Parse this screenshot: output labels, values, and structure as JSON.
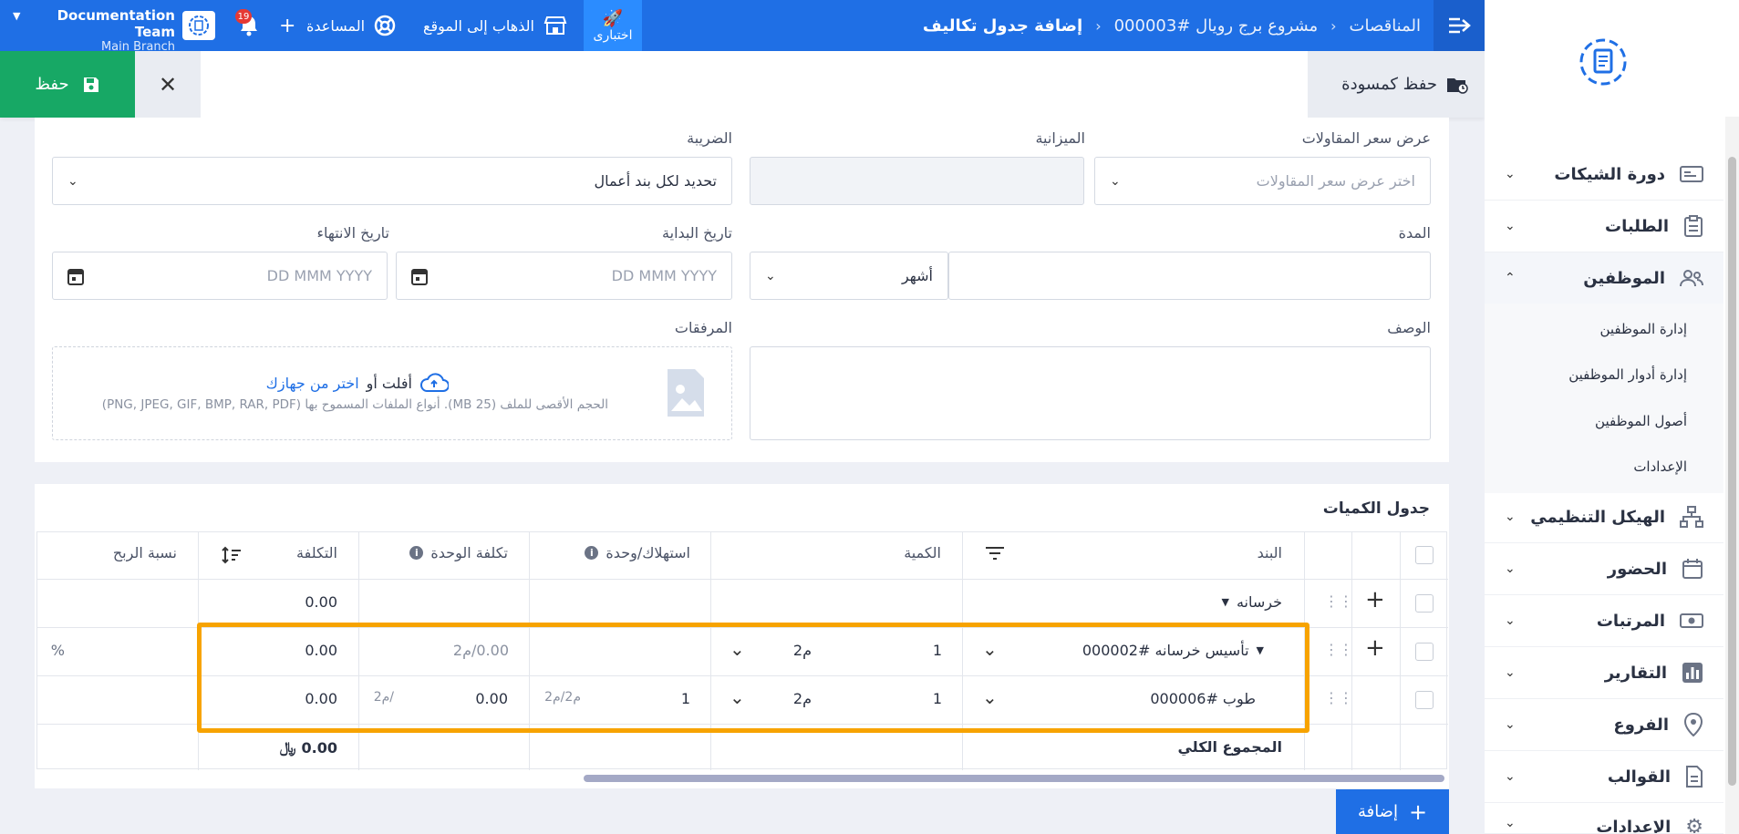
{
  "topbar": {
    "breadcrumbs": [
      "المناقصات",
      "مشروع برج رويال #000003",
      "إضافة جدول تكاليف"
    ],
    "try_label": "اختبارى",
    "go_to_site": "الذهاب إلى الموقع",
    "help": "المساعدة",
    "notifications_count": "19",
    "team_name": "Documentation Team",
    "branch": "Main Branch"
  },
  "actions": {
    "save": "حفظ",
    "save_draft": "حفظ كمسودة"
  },
  "sidebar": {
    "items": [
      {
        "label": "دورة الشيكات",
        "icon": "cheque-icon"
      },
      {
        "label": "الطلبات",
        "icon": "clipboard-icon"
      },
      {
        "label": "الموظفين",
        "icon": "users-icon"
      },
      {
        "label": "الهيكل التنظيمي",
        "icon": "org-chart-icon"
      },
      {
        "label": "الحضور",
        "icon": "calendar-icon"
      },
      {
        "label": "المرتبات",
        "icon": "money-icon"
      },
      {
        "label": "التقارير",
        "icon": "chart-icon"
      },
      {
        "label": "الفروع",
        "icon": "location-icon"
      },
      {
        "label": "القوالب",
        "icon": "document-icon"
      },
      {
        "label": "الإعدادات",
        "icon": "gear-icon"
      }
    ],
    "sub_items": [
      "إدارة الموظفين",
      "إدارة أدوار الموظفين",
      "أصول الموظفين",
      "الإعدادات"
    ]
  },
  "form": {
    "quote_label": "عرض سعر المقاولات",
    "quote_placeholder": "اختر عرض سعر المقاولات",
    "budget_label": "الميزانية",
    "tax_label": "الضريبة",
    "tax_value": "تحديد لكل بند أعمال",
    "duration_label": "المدة",
    "duration_unit": "أشهر",
    "start_label": "تاريخ البداية",
    "end_label": "تاريخ الانتهاء",
    "date_placeholder": "DD MMM YYYY",
    "desc_label": "الوصف",
    "attach_label": "المرفقات",
    "upload_drop": "أفلت أو",
    "upload_pick": "اختر من جهازك",
    "upload_hint": "الحجم الأقصى للملف (25 MB). أنواع الملفات المسموح بها (PNG, JPEG, GIF, BMP, RAR, PDF)"
  },
  "table": {
    "title": "جدول الكميات",
    "headers": {
      "item": "البند",
      "qty": "الكمية",
      "consumption": "استهلاك/وحدة",
      "unit_cost": "تكلفة الوحدة",
      "cost": "التكلفة",
      "profit": "نسبة الربح"
    },
    "group_row": {
      "name": "خرسانه",
      "cost": "0.00"
    },
    "row1": {
      "name": "تأسيس خرسانه #000002",
      "qty": "1",
      "unit": "م2",
      "unit_cost": "0.00/م2",
      "cost": "0.00",
      "profit": "%"
    },
    "row2": {
      "name": "طوب #000006",
      "qty": "1",
      "unit": "م2",
      "consumption": "1",
      "consumption_unit": "م2/م2",
      "unit_cost": "0.00",
      "unit_cost_unit": "/م2",
      "cost": "0.00"
    },
    "total_label": "المجموع الكلي",
    "total_value": "0.00",
    "currency": "﷼"
  },
  "add_button": "إضافة"
}
